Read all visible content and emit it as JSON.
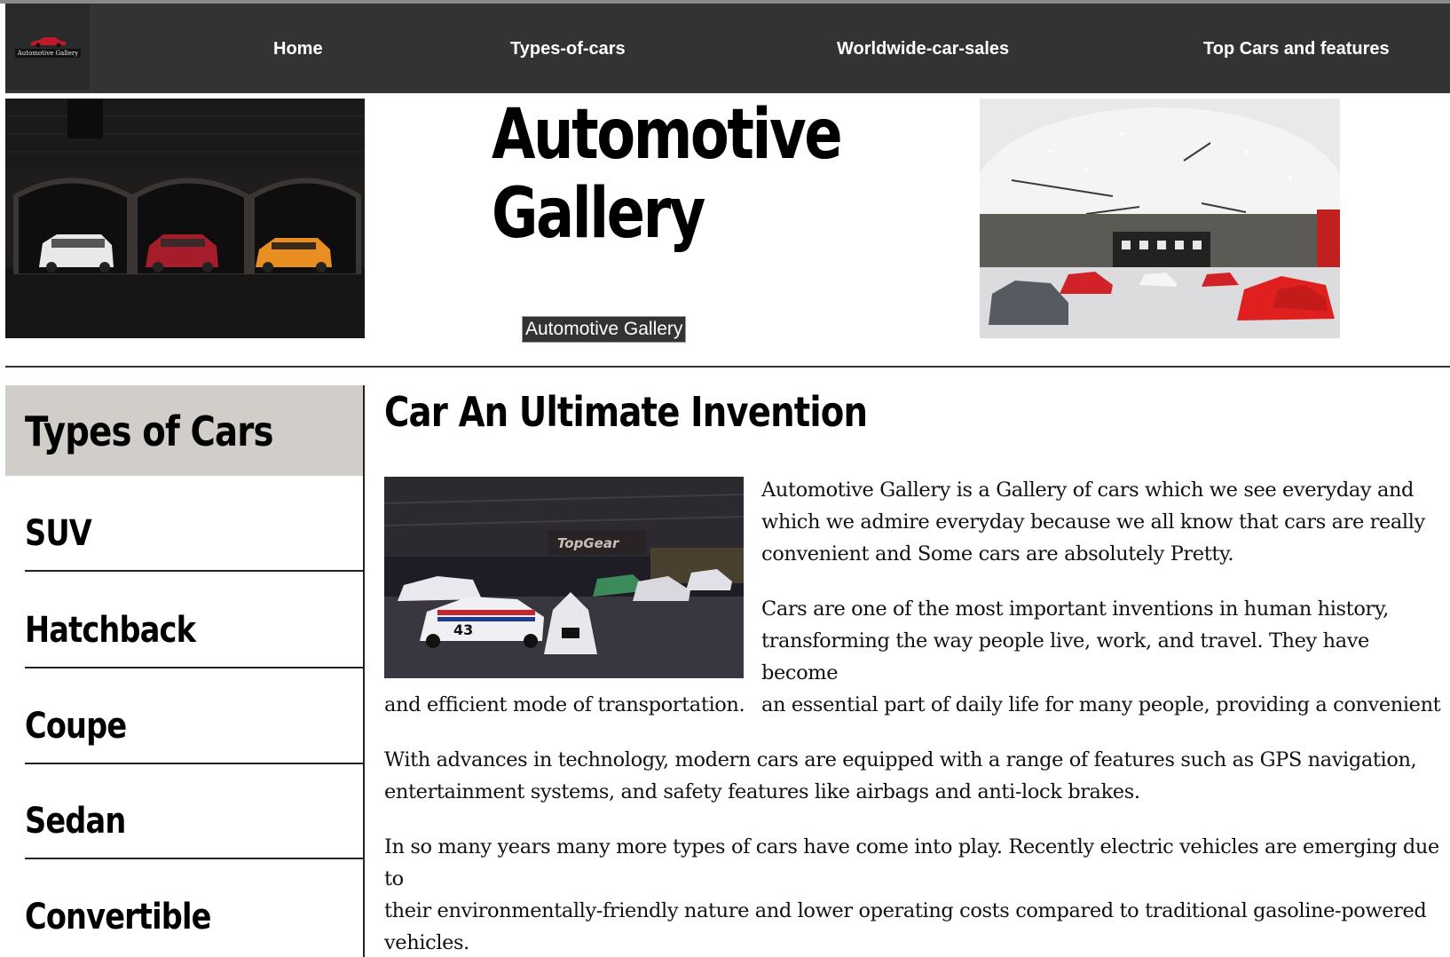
{
  "brand": {
    "logo_text": "Automotive Gallery"
  },
  "nav": {
    "items": [
      "Home",
      "Types-of-cars",
      "Worldwide-car-sales",
      "Top Cars and features"
    ]
  },
  "hero": {
    "title_line1": "Automotive",
    "title_line2": "Gallery",
    "badge": "Automotive Gallery"
  },
  "sidebar": {
    "heading": "Types of Cars",
    "items": [
      "SUV",
      "Hatchback",
      "Coupe",
      "Sedan",
      "Convertible"
    ]
  },
  "main": {
    "title": "Car An Ultimate Invention",
    "p1": "Automotive Gallery is a Gallery of cars which we see everyday and which we admire everyday because we all know that cars are really convenient and Some cars are absolutely Pretty.",
    "p2_lines": [
      "Cars are one of the most important inventions in human history,",
      "transforming the way people live, work, and travel. They have become",
      "an essential part of daily life for many people, providing a convenient",
      "and efficient mode of transportation."
    ],
    "p3_lines": [
      "With advances in technology, modern cars are equipped with a range of features such as GPS navigation,",
      "entertainment systems, and safety features like airbags and anti-lock brakes."
    ],
    "p4_lines": [
      "In so many years many more types of cars have come into play. Recently electric vehicles are emerging due to",
      "their environmentally-friendly nature and lower operating costs compared to traditional gasoline-powered",
      "vehicles."
    ],
    "p1_lines": [
      "Automotive Gallery is a Gallery of cars which we see everyday and",
      "which we admire everyday because we all know that cars are really",
      "convenient and Some cars are absolutely Pretty."
    ]
  },
  "colors": {
    "nav_bg": "#333333",
    "sidebar_head_bg": "#d1ceca",
    "badge_bg": "#333333"
  }
}
